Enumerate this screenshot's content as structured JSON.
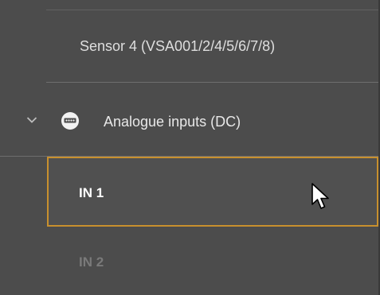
{
  "tree": {
    "sensor_item": {
      "label": "Sensor 4 (VSA001/2/4/5/6/7/8)"
    },
    "group": {
      "label": "Analogue inputs (DC)",
      "expand_icon": "chevron-down-icon",
      "group_icon": "analog-input-icon",
      "expanded": true
    },
    "items": [
      {
        "label": "IN 1",
        "selected": true,
        "enabled": true
      },
      {
        "label": "IN 2",
        "selected": false,
        "enabled": false
      }
    ]
  },
  "colors": {
    "background": "#4c4c4c",
    "selection_border": "#c8902e",
    "text_primary": "#e8e8e8",
    "text_disabled": "#7a7a7a"
  }
}
